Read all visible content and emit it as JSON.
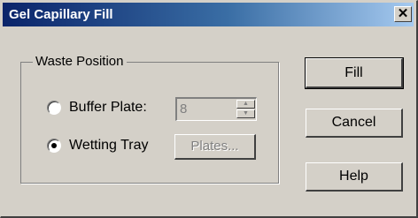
{
  "window": {
    "title": "Gel Capillary Fill",
    "close_glyph": "✕"
  },
  "waste_position": {
    "group_label": "Waste Position",
    "options": [
      {
        "label": "Buffer Plate:",
        "selected": false
      },
      {
        "label": "Wetting Tray",
        "selected": true
      }
    ],
    "buffer_plate_value": "8",
    "plates_button": "Plates..."
  },
  "buttons": {
    "fill": "Fill",
    "cancel": "Cancel",
    "help": "Help"
  }
}
